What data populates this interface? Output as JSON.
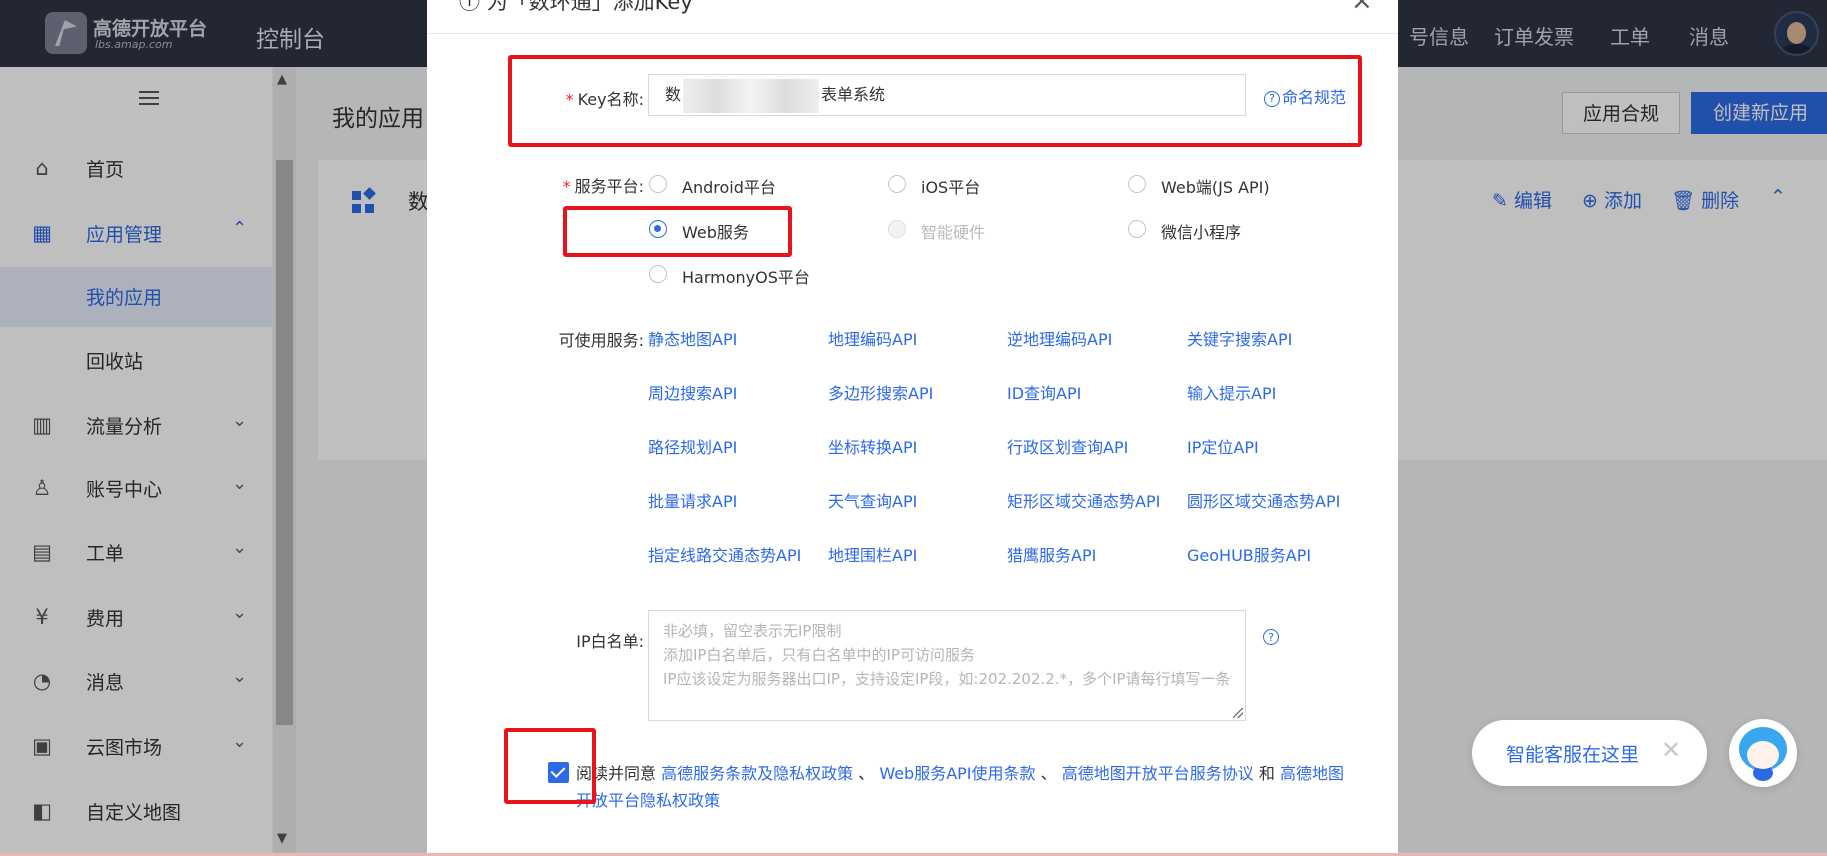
{
  "topbar": {
    "brand_name": "高德开放平台",
    "brand_url": "lbs.amap.com",
    "console": "控制台",
    "nav": [
      "号信息",
      "订单发票",
      "工单",
      "消息"
    ]
  },
  "sidebar": {
    "items": [
      {
        "label": "首页",
        "icon": "home-icon",
        "glyph": "⌂"
      },
      {
        "label": "应用管理",
        "icon": "apps-icon",
        "glyph": "▦",
        "chevron": "⌃"
      },
      {
        "label": "流量分析",
        "icon": "chart-icon",
        "glyph": "▥",
        "chevron": "⌄"
      },
      {
        "label": "账号中心",
        "icon": "user-icon",
        "glyph": "♙",
        "chevron": "⌄"
      },
      {
        "label": "工单",
        "icon": "ticket-icon",
        "glyph": "▤",
        "chevron": "⌄"
      },
      {
        "label": "费用",
        "icon": "yen-icon",
        "glyph": "¥",
        "chevron": "⌄"
      },
      {
        "label": "消息",
        "icon": "message-icon",
        "glyph": "◔",
        "chevron": "⌄"
      },
      {
        "label": "云图市场",
        "icon": "store-icon",
        "glyph": "▣",
        "chevron": "⌄"
      },
      {
        "label": "自定义地图",
        "icon": "map-icon",
        "glyph": "◧"
      }
    ],
    "sub_items": [
      {
        "label": "我的应用"
      },
      {
        "label": "回收站"
      }
    ]
  },
  "main": {
    "page_title": "我的应用",
    "compliance_button": "应用合规",
    "create_button": "创建新应用",
    "app_name": "数",
    "actions": {
      "edit": "编辑",
      "add": "添加",
      "delete": "删除"
    }
  },
  "modal": {
    "title": "为「数环通」添加Key",
    "key_name_label": "Key名称:",
    "key_name_value_start": "数",
    "key_name_value_end": "表单系统",
    "naming_rule": "命名规范",
    "platform_label": "服务平台:",
    "platforms": [
      {
        "label": "Android平台",
        "checked": false,
        "disabled": false
      },
      {
        "label": "iOS平台",
        "checked": false,
        "disabled": false
      },
      {
        "label": "Web端(JS API)",
        "checked": false,
        "disabled": false
      },
      {
        "label": "Web服务",
        "checked": true,
        "disabled": false
      },
      {
        "label": "智能硬件",
        "checked": false,
        "disabled": true
      },
      {
        "label": "微信小程序",
        "checked": false,
        "disabled": false
      },
      {
        "label": "HarmonyOS平台",
        "checked": false,
        "disabled": false
      }
    ],
    "services_label": "可使用服务:",
    "services": [
      "静态地图API",
      "地理编码API",
      "逆地理编码API",
      "关键字搜索API",
      "周边搜索API",
      "多边形搜索API",
      "ID查询API",
      "输入提示API",
      "路径规划API",
      "坐标转换API",
      "行政区划查询API",
      "IP定位API",
      "批量请求API",
      "天气查询API",
      "矩形区域交通态势API",
      "圆形区域交通态势API",
      "指定线路交通态势API",
      "地理围栏API",
      "猎鹰服务API",
      "GeoHUB服务API"
    ],
    "ip_label": "IP白名单:",
    "ip_placeholder": [
      "非必填，留空表示无IP限制",
      "添加IP白名单后，只有白名单中的IP可访问服务",
      "IP应该设定为服务器出口IP，支持设定IP段，如:202.202.2.*，多个IP请每行填写一条"
    ],
    "agree": {
      "prefix": "阅读并同意",
      "link1": "高德服务条款及隐私权政策",
      "sep1": "、",
      "link2": "Web服务API使用条款",
      "sep2": "、",
      "link3": "高德地图开放平台服务协议",
      "sep3": "和",
      "link4": "高德地图开放平台隐私权政策"
    }
  },
  "chat": {
    "label": "智能客服在这里"
  },
  "colors": {
    "accent": "#2d6ae6",
    "topbar": "#2f3445",
    "highlight": "#e8131b"
  }
}
